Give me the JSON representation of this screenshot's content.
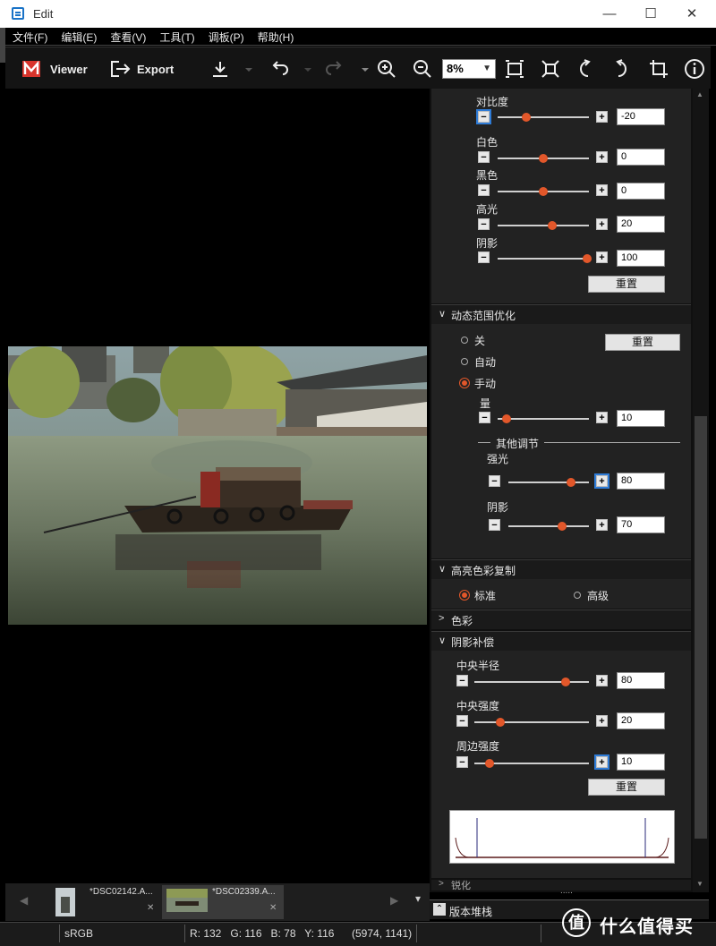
{
  "window": {
    "title": "Edit",
    "min_glyph": "—",
    "max_glyph": "☐",
    "close_glyph": "✕"
  },
  "menu": [
    "文件(F)",
    "编辑(E)",
    "查看(V)",
    "工具(T)",
    "调板(P)",
    "帮助(H)"
  ],
  "toolbar": {
    "viewer_label": "Viewer",
    "export_label": "Export",
    "zoom_value": "8%"
  },
  "tone": {
    "rows": [
      {
        "label": "对比度",
        "value": "-20",
        "pos": 0.31
      },
      {
        "label": "白色",
        "value": "0",
        "pos": 0.5
      },
      {
        "label": "黑色",
        "value": "0",
        "pos": 0.5
      },
      {
        "label": "高光",
        "value": "20",
        "pos": 0.6
      },
      {
        "label": "阴影",
        "value": "100",
        "pos": 0.98
      }
    ],
    "reset": "重置"
  },
  "dro": {
    "title": "动态范围优化",
    "options": [
      "关",
      "自动",
      "手动"
    ],
    "selected": "手动",
    "reset": "重置",
    "amount_label": "量",
    "amount_value": "10",
    "amount_pos": 0.1,
    "other_title": "其他调节",
    "highlight_label": "强光",
    "highlight_value": "80",
    "highlight_pos": 0.78,
    "shadow_label": "阴影",
    "shadow_value": "70",
    "shadow_pos": 0.67
  },
  "hl_color": {
    "title": "高亮色彩复制",
    "options": [
      "标准",
      "高级"
    ],
    "selected": "标准"
  },
  "color": {
    "title": "色彩"
  },
  "vignette": {
    "title": "阴影补偿",
    "rows": [
      {
        "label": "中央半径",
        "value": "80",
        "pos": 0.8
      },
      {
        "label": "中央强度",
        "value": "20",
        "pos": 0.23
      },
      {
        "label": "周边强度",
        "value": "10",
        "pos": 0.13
      }
    ],
    "reset": "重置"
  },
  "sharpen": {
    "title": "锐化"
  },
  "stack": {
    "label": "版本堆栈",
    "more": "....."
  },
  "filmstrip": {
    "items": [
      {
        "name": "*DSC02142.A...",
        "close": "✕"
      },
      {
        "name": "*DSC02339.A...",
        "close": "✕"
      }
    ]
  },
  "status": {
    "colorspace": "sRGB",
    "rgb": "R: 132   G: 116   B: 78   Y: 116",
    "coords": "(5974, 1141)"
  },
  "watermark": {
    "logo": "值",
    "text": "什么值得买"
  }
}
